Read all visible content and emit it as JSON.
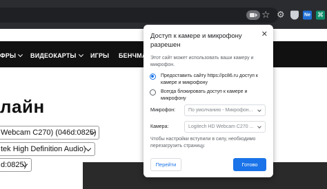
{
  "toolbar": {
    "icons": [
      "camera-in-use-icon",
      "star-icon",
      "extension-icon",
      "shield-extension-icon",
      "extension-box-icon",
      "extension-puzzle-icon"
    ],
    "star_glyph": "☆",
    "ext_box_text": "Ne",
    "ext_puzzle_text": "⌘"
  },
  "site_nav": {
    "items": [
      {
        "label": "ФРЫ",
        "chevron": true
      },
      {
        "label": "ВИДЕОКАРТЫ",
        "chevron": true
      },
      {
        "label": "ИГРЫ",
        "chevron": false
      },
      {
        "label": "БЕНЧМА",
        "chevron": false
      }
    ]
  },
  "page": {
    "heading": "лайн",
    "selects": [
      "Webcam C270) (046d:0825)",
      "tek High Definition Audio)",
      "d:0825)"
    ]
  },
  "popup": {
    "title": "Доступ к камере и микрофону разрешен",
    "description": "Этот сайт может использовать ваши камеру и микрофон.",
    "options": [
      {
        "label": "Предоставить сайту https://pc86.ru доступ к камере и микрофону",
        "checked": true
      },
      {
        "label": "Всегда блокировать доступ к камере и микрофону",
        "checked": false
      }
    ],
    "microphone_label": "Микрофон:",
    "microphone_value": "По умолчанию - Микрофон...",
    "camera_label": "Камера:",
    "camera_value": "Logitech HD Webcam C270 ...",
    "note": "Чтобы настройки вступили в силу, необходимо перезагрузить страницу.",
    "manage_button": "Перейти",
    "done_button": "Готово",
    "close_glyph": "✕"
  },
  "colors": {
    "toolbar_bg": "#2b2c30",
    "nav_bg": "#111111",
    "accent": "#1a73e8"
  }
}
